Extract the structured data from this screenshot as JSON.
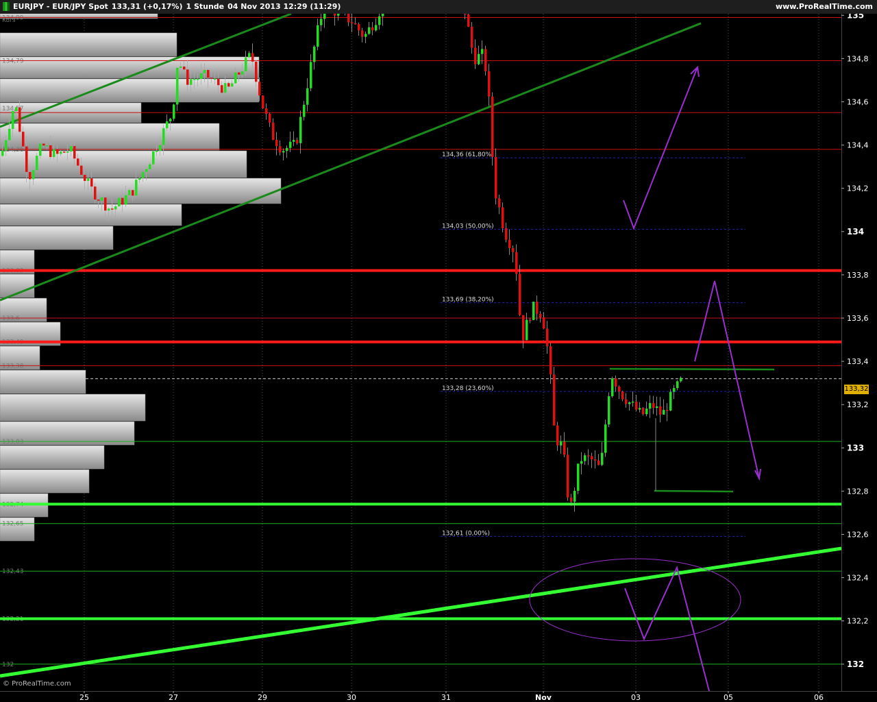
{
  "header": {
    "instrument": "EURJPY - EUR/JPY Spot",
    "quote": "133,31 (+0,17%)",
    "interval": "1 Stunde",
    "timestamp": "04 Nov 2013 12:29 (11:29)",
    "site": "www.ProRealTime.com"
  },
  "watermark": "© ProRealTime.com",
  "current_price_label": "133,32",
  "chart_data": {
    "type": "candlestick",
    "title": "EURJPY - EUR/JPY Spot",
    "ylim": [
      131.95,
      135.05
    ],
    "y_ticks": [
      "135",
      "134,8",
      "134,6",
      "134,4",
      "134,2",
      "134",
      "133,8",
      "133,6",
      "133,4",
      "133,2",
      "133",
      "132,8",
      "132,6",
      "132,4",
      "132,2",
      "132"
    ],
    "x_ticks": [
      "25",
      "27",
      "29",
      "30",
      "31",
      "Nov",
      "03",
      "05",
      "06"
    ],
    "volume_profile_title": "Kurs",
    "volume_profile": [
      {
        "price": 134.99,
        "label": "134,99"
      },
      {
        "price": 134.79,
        "label": "134,79"
      },
      {
        "price": 134.57,
        "label": "134,57"
      },
      {
        "price": 134.38,
        "label": "134,38"
      },
      {
        "price": 133.82,
        "label": "133,82"
      },
      {
        "price": 133.6,
        "label": "133,6"
      },
      {
        "price": 133.49,
        "label": "133,49"
      },
      {
        "price": 133.38,
        "label": "133,38"
      },
      {
        "price": 133.03,
        "label": "133,03"
      },
      {
        "price": 132.74,
        "label": "132,74"
      },
      {
        "price": 132.65,
        "label": "132,65"
      },
      {
        "price": 132.43,
        "label": "132,43"
      },
      {
        "price": 132.21,
        "label": "132,21"
      },
      {
        "price": 132.0,
        "label": "132"
      }
    ],
    "fibonacci": [
      {
        "price": 134.36,
        "label": "134,36 (61,80%)"
      },
      {
        "price": 134.03,
        "label": "134,03 (50,00%)"
      },
      {
        "price": 133.69,
        "label": "133,69 (38,20%)"
      },
      {
        "price": 133.28,
        "label": "133,28 (23,60%)"
      },
      {
        "price": 132.61,
        "label": "132,61 (0,00%)"
      }
    ],
    "resistance_lines": [
      133.82,
      133.49
    ],
    "support_lines": [
      132.74,
      132.21
    ],
    "current_price": 133.32,
    "colors": {
      "up": "#22dd22",
      "down": "#e01010",
      "resistance": "#ff1a1a",
      "support": "#33ff33",
      "trend": "#1a8a1a",
      "projection": "#9a2fd0",
      "fib": "#2020c0",
      "profile": "#c8c8c8"
    }
  }
}
